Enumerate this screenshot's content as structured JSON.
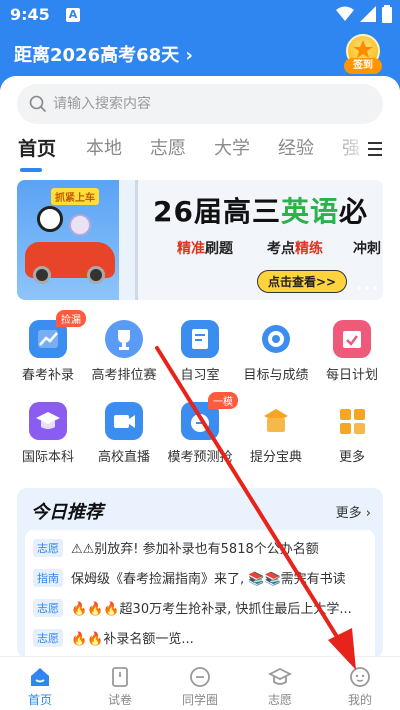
{
  "status": {
    "time": "9:45",
    "notif_letter": "A"
  },
  "header": {
    "countdown": "距离2026高考68天",
    "checkin_label": "签到"
  },
  "search": {
    "placeholder": "请输入搜索内容"
  },
  "tabs": [
    "首页",
    "本地",
    "志愿",
    "大学",
    "经验",
    "强"
  ],
  "banner": {
    "tag": "抓紧上车",
    "title_a": "26届高三",
    "title_b": "英语",
    "title_c": "必",
    "sub_1a": "精准",
    "sub_1b": "刷题",
    "sub_2a": "考点",
    "sub_2b": "精练",
    "sub_3a": "冲刺",
    "button": "点击查看>>"
  },
  "grid": [
    {
      "label": "春考补录",
      "badge": "捡漏",
      "icon": "chart-icon",
      "color": "#2f86f0"
    },
    {
      "label": "高考排位赛",
      "badge": "",
      "icon": "trophy-icon",
      "color": "#4a90f0"
    },
    {
      "label": "自习室",
      "badge": "",
      "icon": "notebook-icon",
      "color": "#2f86f0"
    },
    {
      "label": "目标与成绩",
      "badge": "",
      "icon": "target-icon",
      "color": "#2f86f0"
    },
    {
      "label": "每日计划",
      "badge": "",
      "icon": "calendar-check-icon",
      "color": "#f05a7a"
    },
    {
      "label": "国际本科",
      "badge": "",
      "icon": "graduation-cap-icon",
      "color": "#8a5cf0"
    },
    {
      "label": "高校直播",
      "badge": "",
      "icon": "video-icon",
      "color": "#2f86f0"
    },
    {
      "label": "模考预测抢",
      "badge": "一模",
      "icon": "exam-icon",
      "color": "#2f86f0"
    },
    {
      "label": "提分宝典",
      "badge": "",
      "icon": "book-icon",
      "color": "#f5a623"
    },
    {
      "label": "更多",
      "badge": "",
      "icon": "grid-more-icon",
      "color": "#f5a623"
    }
  ],
  "recommend": {
    "title": "今日推荐",
    "more": "更多 ›",
    "items": [
      {
        "tag": "志愿",
        "text": "⚠⚠别放弃! 参加补录也有5818个公办名额"
      },
      {
        "tag": "指南",
        "text": "保姆级《春考捡漏指南》来了, 📚📚需完有书读"
      },
      {
        "tag": "志愿",
        "text": "🔥🔥🔥超30万考生抢补录, 快抓住最后上大学..."
      },
      {
        "tag": "志愿",
        "text": "🔥🔥补录名额一览..."
      }
    ]
  },
  "nav": [
    {
      "label": "首页",
      "icon": "home-icon"
    },
    {
      "label": "试卷",
      "icon": "paper-icon"
    },
    {
      "label": "同学圈",
      "icon": "circle-icon"
    },
    {
      "label": "志愿",
      "icon": "cap-icon"
    },
    {
      "label": "我的",
      "icon": "profile-icon"
    }
  ],
  "colors": {
    "brand": "#2f86f0",
    "annotation_arrow": "#e8231b"
  }
}
